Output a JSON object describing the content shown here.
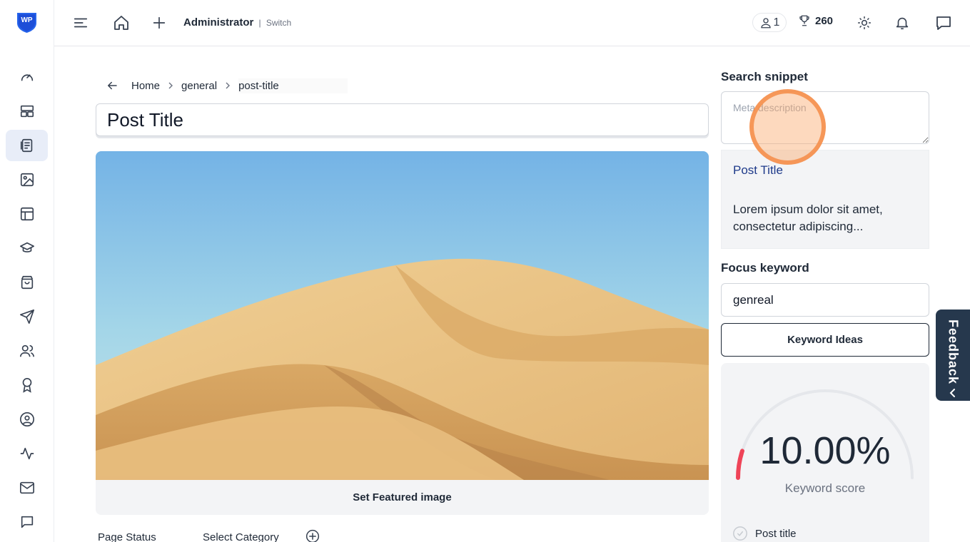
{
  "topbar": {
    "logo_text": "WP",
    "user_name": "Administrator",
    "separator": "|",
    "switch_label": "Switch",
    "users_count": "1",
    "points": "260"
  },
  "sidebar": {
    "items": [
      {
        "icon": "dashboard-gauge-icon"
      },
      {
        "icon": "layout-icon"
      },
      {
        "icon": "pages-icon",
        "active": true
      },
      {
        "icon": "image-icon"
      },
      {
        "icon": "table-icon"
      },
      {
        "icon": "graduation-cap-icon"
      },
      {
        "icon": "shopping-bag-icon"
      },
      {
        "icon": "send-icon"
      },
      {
        "icon": "users-icon"
      },
      {
        "icon": "award-icon"
      },
      {
        "icon": "user-circle-icon"
      },
      {
        "icon": "activity-icon"
      },
      {
        "icon": "mail-icon"
      },
      {
        "icon": "chat-icon"
      }
    ]
  },
  "breadcrumb": {
    "items": [
      "Home",
      "general",
      "post-title"
    ]
  },
  "editor": {
    "title_value": "Post Title",
    "featured_image_label": "Set Featured image",
    "page_status_label": "Page Status",
    "category_label": "Select Category"
  },
  "seo": {
    "snippet_heading": "Search snippet",
    "meta_placeholder": "Meta description",
    "preview_title": "Post Title",
    "preview_text": "Lorem ipsum dolor sit amet, consectetur adipiscing...",
    "focus_heading": "Focus keyword",
    "focus_value": "genreal",
    "keyword_ideas_label": "Keyword Ideas",
    "score_value": "10.00%",
    "score_fraction": 0.1,
    "score_label": "Keyword score",
    "checks": [
      "Post title"
    ]
  },
  "feedback": {
    "label": "Feedback"
  },
  "colors": {
    "accent": "#1e3a8a",
    "gauge_track": "#e5e7eb",
    "gauge_fill": "#ef4458",
    "feedback_bg": "#26384d",
    "active_bg": "#e8edf8"
  }
}
